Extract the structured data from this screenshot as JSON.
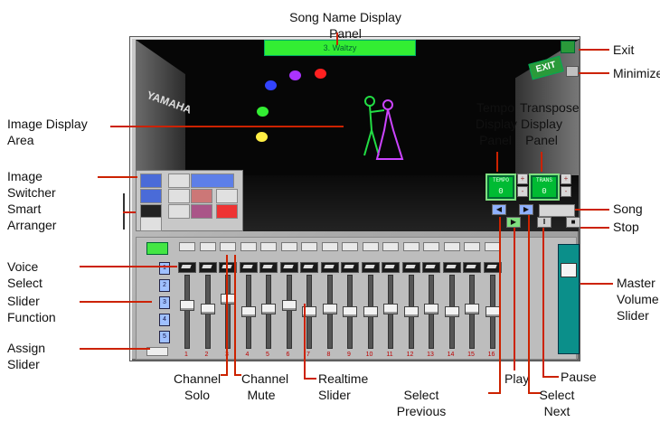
{
  "labels": {
    "song_name_display": "Song Name Display Panel",
    "exit": "Exit",
    "minimize": "Minimize",
    "image_display_area": "Image Display Area",
    "tempo_display": "Tempo Display Panel",
    "transpose_display": "Transpose Display Panel",
    "image_switcher": "Image Switcher",
    "smart_arranger": "Smart Arranger",
    "song": "Song",
    "stop": "Stop",
    "voice_select": "Voice Select",
    "slider_function": "Slider Function",
    "assign_slider": "Assign Slider",
    "master_volume": "Master Volume Slider",
    "channel_solo": "Channel Solo",
    "channel_mute": "Channel Mute",
    "realtime_slider": "Realtime Slider",
    "select_previous": "Select Previous",
    "play": "Play",
    "select_next": "Select Next",
    "pause": "Pause"
  },
  "app": {
    "song_name": "3. Waltzy",
    "tempo": "0",
    "transpose": "0",
    "tempo_label": "TEMPO",
    "transpose_label": "TRANS",
    "exit_sign": "EXIT",
    "brand": "YAMAHA"
  },
  "channels": [
    {
      "num": "1",
      "level": 0.6
    },
    {
      "num": "2",
      "level": 0.55
    },
    {
      "num": "3",
      "level": 0.7
    },
    {
      "num": "4",
      "level": 0.5
    },
    {
      "num": "5",
      "level": 0.55
    },
    {
      "num": "6",
      "level": 0.6
    },
    {
      "num": "7",
      "level": 0.5
    },
    {
      "num": "8",
      "level": 0.55
    },
    {
      "num": "9",
      "level": 0.5
    },
    {
      "num": "10",
      "level": 0.5
    },
    {
      "num": "11",
      "level": 0.55
    },
    {
      "num": "12",
      "level": 0.5
    },
    {
      "num": "13",
      "level": 0.55
    },
    {
      "num": "14",
      "level": 0.5
    },
    {
      "num": "15",
      "level": 0.55
    },
    {
      "num": "16",
      "level": 0.5
    }
  ],
  "master_level": 0.8,
  "colors": {
    "callout_line": "#cc2200",
    "led": "#00bb33",
    "master": "#0b8f8a"
  }
}
